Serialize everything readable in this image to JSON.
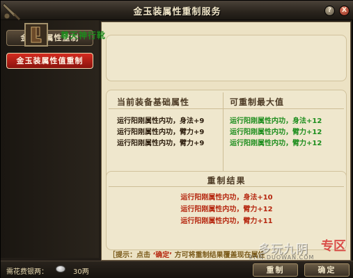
{
  "window": {
    "title": "金玉装属性重制服务",
    "help_glyph": "?",
    "close_glyph": "X"
  },
  "sidebar": {
    "items": [
      {
        "label": "金玉装属性重制",
        "active": false
      },
      {
        "label": "金玉装属性值重制",
        "active": true
      }
    ]
  },
  "item": {
    "name": "尊天神行靴",
    "icon": "boots-icon"
  },
  "compare": {
    "current_header": "当前装备基础属性",
    "max_header": "可重制最大值",
    "current": [
      "运行阳刚属性内功，身法+9",
      "运行阳刚属性内功，臂力+9",
      "运行阳刚属性内功，臂力+9"
    ],
    "max": [
      "运行阳刚属性内功，身法+12",
      "运行阳刚属性内功，臂力+12",
      "运行阳刚属性内功，臂力+12"
    ]
  },
  "result": {
    "title": "重制结果",
    "lines": [
      "运行阳刚属性内功，身法+10",
      "运行阳刚属性内功，臂力+12",
      "运行阳刚属性内功，臂力+11"
    ]
  },
  "hint": {
    "prefix": "［提示：点击",
    "quoted": "‘确定’",
    "suffix": "方可将重制结果覆盖现在属性"
  },
  "footer": {
    "cost_label": "需花费银两：",
    "cost_value": "30两",
    "recast_label": "重制",
    "confirm_label": "确定"
  },
  "watermark": {
    "text": "多玩九阴",
    "seal": "专区",
    "url": "9YIN.DUOWAN.COM"
  },
  "colors": {
    "accent_red": "#b5260e",
    "stat_green": "#1e8e1e",
    "active_tab": "#d42c20"
  }
}
